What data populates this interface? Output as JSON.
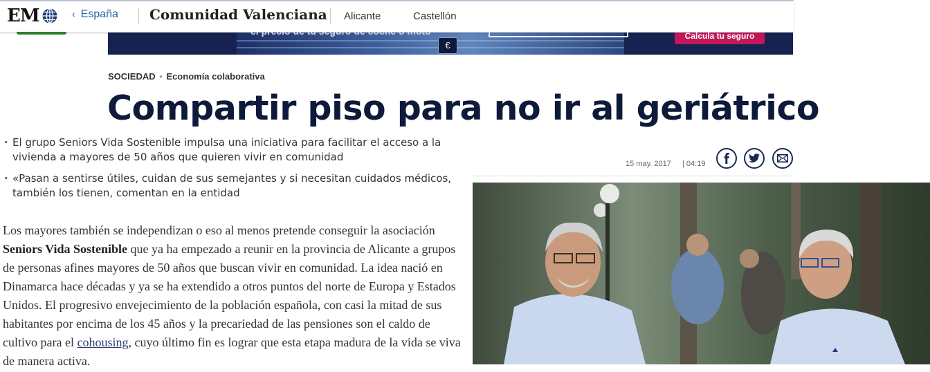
{
  "ad": {
    "text": "el precio de tu seguro de coche o moto",
    "euro": "€",
    "cta_label": "Calcula tu seguro"
  },
  "nav": {
    "logo_text": "EM",
    "back_label": "España",
    "region": "Comunidad Valenciana",
    "cities": [
      "Alicante",
      "Castellón"
    ]
  },
  "article": {
    "section": "SOCIEDAD",
    "subsection": "Economía colaborativa",
    "headline": "Compartir piso para no ir al geriátrico",
    "summary": [
      "El grupo Seniors Vida Sostenible impulsa una iniciativa para facilitar el acceso a la vivienda a mayores de 50 años que quieren vivir en comunidad",
      "«Pasan a sentirse útiles, cuidan de sus semejantes y si necesitan cuidados médicos, también los tienen, comentan en la entidad"
    ],
    "body": {
      "part1": "Los mayores también se independizan o eso al menos pretende conseguir la asociación ",
      "bold": "Seniors Vida Sostenible",
      "part2": " que ya ha empezado a reunir en la provincia de Alicante a grupos de personas afines mayores de 50 años que buscan vivir en comunidad. La idea nació en Dinamarca hace décadas y ya se ha extendido a otros puntos del norte de Europa y Estados Unidos. El progresivo envejecimiento de la población española, con casi la mitad de sus habitantes por encima de los 45 años y la precariedad de las pensiones son el caldo de cultivo para el ",
      "link": "cohousing",
      "part3": ", cuyo último fin es lograr que esta etapa madura de la vida se viva de manera activa."
    },
    "date": "15 may. 2017",
    "time": "| 04:19"
  },
  "share": {
    "icons": [
      "facebook-icon",
      "twitter-icon",
      "mail-icon"
    ],
    "color": "#1a2a52"
  },
  "colors": {
    "headline": "#0d1a3a",
    "link": "#2a62a8",
    "ad_cta": "#c2185b",
    "ad_bg": "#16224f"
  }
}
